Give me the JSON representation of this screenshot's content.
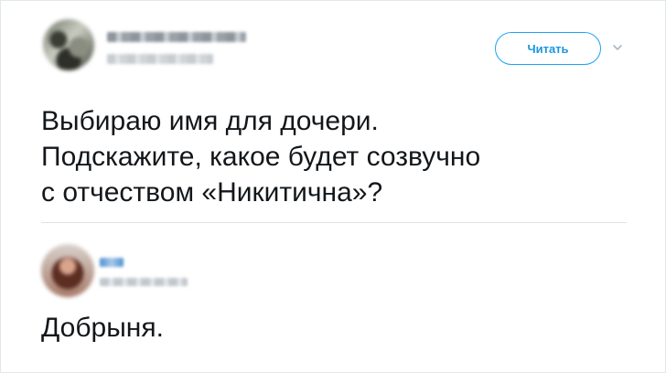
{
  "tweet": {
    "follow_label": "Читать",
    "text_lines": [
      "Выбираю имя для дочери.",
      "Подскажите, какое будет созвучно",
      "с отчеством «Никитична»?"
    ]
  },
  "reply": {
    "text": "Добрыня."
  },
  "colors": {
    "accent": "#1da1f2",
    "text": "#14171a",
    "divider": "#dfe3e6"
  },
  "icons": {
    "menu": "chevron-down-icon"
  }
}
